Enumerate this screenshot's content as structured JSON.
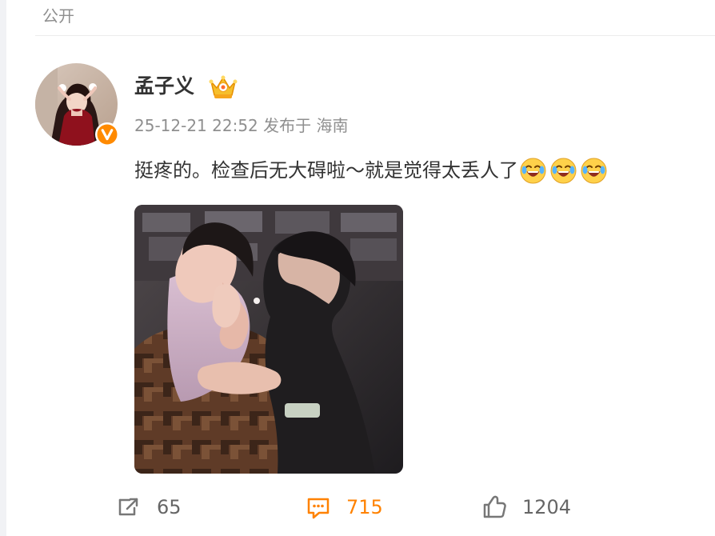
{
  "header": {
    "visibility_label": "公开"
  },
  "author": {
    "name": "孟子义",
    "avatar_icon": "user-avatar-photo",
    "verified_icon": "orange-verified-v-icon",
    "member_icon": "gold-crown-icon"
  },
  "post": {
    "timestamp": "25-12-21 22:52",
    "location_label": "发布于 海南",
    "text": "挺疼的。检查后无大碍啦～就是觉得太丢人了",
    "emojis": [
      "laugh-cry-emoji",
      "laugh-cry-emoji",
      "laugh-cry-emoji"
    ],
    "image_alt": "post-photo"
  },
  "actions": {
    "repost_count": "65",
    "comment_count": "715",
    "like_count": "1204"
  },
  "colors": {
    "accent_orange": "#ff8200",
    "secondary_text": "#8f8f8f",
    "primary_text": "#333333"
  }
}
